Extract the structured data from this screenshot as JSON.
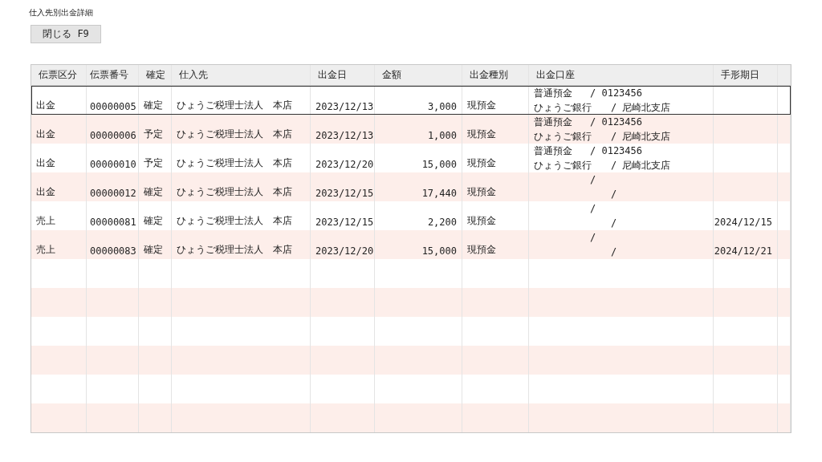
{
  "window": {
    "title": "仕入先別出金詳細"
  },
  "close_button": {
    "label": "閉じる F9"
  },
  "table": {
    "columns": [
      "伝票区分",
      "伝票番号",
      "確定",
      "仕入先",
      "出金日",
      "金額",
      "出金種別",
      "出金口座",
      "手形期日"
    ],
    "rows": [
      {
        "selected": true,
        "slip_type": "出金",
        "slip_no": "00000005",
        "status": "確定",
        "supplier": "ひょうご税理士法人　本店",
        "date": "2023/12/13",
        "amount": "3,000",
        "payment_type": "現預金",
        "account": {
          "deposit_type": "普通預金",
          "account_no": "/ 0123456",
          "bank": "ひょうご銀行",
          "branch": "/ 尼崎北支店"
        }
      },
      {
        "selected": false,
        "slip_type": "出金",
        "slip_no": "00000006",
        "status": "予定",
        "supplier": "ひょうご税理士法人　本店",
        "date": "2023/12/13",
        "amount": "1,000",
        "payment_type": "現預金",
        "account": {
          "deposit_type": "普通預金",
          "account_no": "/ 0123456",
          "bank": "ひょうご銀行",
          "branch": "/ 尼崎北支店"
        }
      },
      {
        "selected": false,
        "slip_type": "出金",
        "slip_no": "00000010",
        "status": "予定",
        "supplier": "ひょうご税理士法人　本店",
        "date": "2023/12/20",
        "amount": "15,000",
        "payment_type": "現預金",
        "account": {
          "deposit_type": "普通預金",
          "account_no": "/ 0123456",
          "bank": "ひょうご銀行",
          "branch": "/ 尼崎北支店"
        }
      },
      {
        "selected": false,
        "slip_type": "出金",
        "slip_no": "00000012",
        "status": "確定",
        "supplier": "ひょうご税理士法人　本店",
        "date": "2023/12/15",
        "amount": "17,440",
        "payment_type": "現預金",
        "account": {
          "account_no": "/",
          "branch": "/"
        }
      },
      {
        "selected": false,
        "slip_type": "売上",
        "slip_no": "00000081",
        "status": "確定",
        "supplier": "ひょうご税理士法人　本店",
        "date": "2023/12/15",
        "amount": "2,200",
        "payment_type": "現預金",
        "account": {
          "account_no": "/",
          "branch": "/"
        },
        "note_due": "2024/12/15"
      },
      {
        "selected": false,
        "slip_type": "売上",
        "slip_no": "00000083",
        "status": "確定",
        "supplier": "ひょうご税理士法人　本店",
        "date": "2023/12/20",
        "amount": "15,000",
        "payment_type": "現預金",
        "account": {
          "account_no": "/",
          "branch": "/"
        },
        "note_due": "2024/12/21"
      }
    ]
  }
}
